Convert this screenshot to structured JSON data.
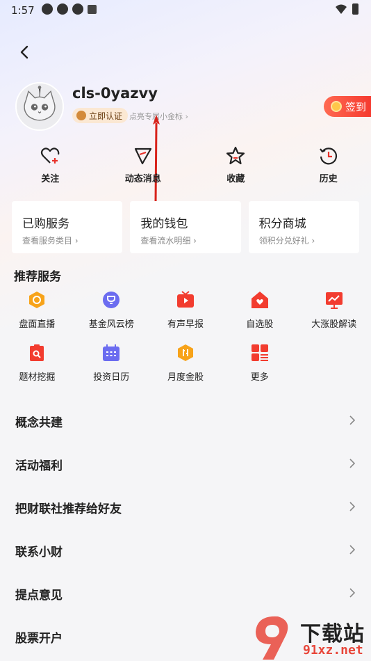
{
  "status_bar": {
    "time": "1:57"
  },
  "profile": {
    "username": "cls-0yazvy",
    "verify_label": "立即认证",
    "hint": "点亮专属小金标 ›",
    "checkin_label": "签到"
  },
  "quick_actions": [
    {
      "label": "关注",
      "icon": "heart-plus-icon"
    },
    {
      "label": "动态消息",
      "icon": "paper-plane-icon"
    },
    {
      "label": "收藏",
      "icon": "star-icon"
    },
    {
      "label": "历史",
      "icon": "history-clock-icon"
    }
  ],
  "cards": [
    {
      "title": "已购服务",
      "subtitle": "查看服务类目 ›"
    },
    {
      "title": "我的钱包",
      "subtitle": "查看流水明细 ›"
    },
    {
      "title": "积分商城",
      "subtitle": "领积分兑好礼 ›"
    }
  ],
  "recommended": {
    "title": "推荐服务",
    "items": [
      {
        "label": "盘面直播",
        "icon": "live-dashboard-icon",
        "color": "#f7a31a"
      },
      {
        "label": "基金风云榜",
        "icon": "trophy-icon",
        "color": "#6b6cf0"
      },
      {
        "label": "有声早报",
        "icon": "tv-play-icon",
        "color": "#f23c2f"
      },
      {
        "label": "自选股",
        "icon": "home-heart-icon",
        "color": "#f23c2f"
      },
      {
        "label": "大涨股解读",
        "icon": "chart-up-icon",
        "color": "#f23c2f"
      },
      {
        "label": "题材挖掘",
        "icon": "clipboard-search-icon",
        "color": "#f23c2f"
      },
      {
        "label": "投资日历",
        "icon": "calendar-icon",
        "color": "#6b6cf0"
      },
      {
        "label": "月度金股",
        "icon": "gold-hexagon-icon",
        "color": "#f7a31a"
      },
      {
        "label": "更多",
        "icon": "grid-more-icon",
        "color": "#f23c2f"
      }
    ]
  },
  "menu": [
    {
      "label": "概念共建"
    },
    {
      "label": "活动福利"
    },
    {
      "label": "把财联社推荐给好友"
    },
    {
      "label": "联系小财"
    },
    {
      "label": "提点意见"
    },
    {
      "label": "股票开户"
    }
  ],
  "watermark": {
    "text": "下载站",
    "url": "91xz.net"
  }
}
